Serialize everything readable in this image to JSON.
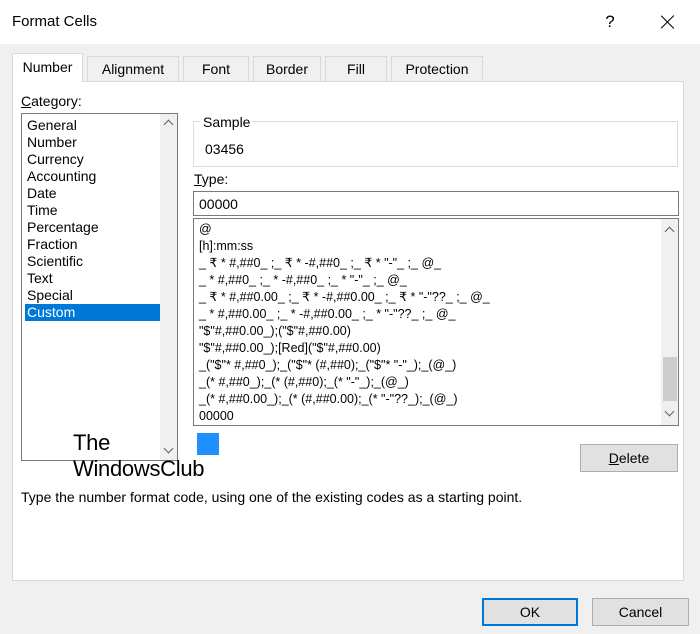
{
  "window": {
    "title": "Format Cells",
    "help": "?",
    "close_icon": "close-icon"
  },
  "tabs": [
    {
      "label": "Number",
      "active": true
    },
    {
      "label": "Alignment"
    },
    {
      "label": "Font"
    },
    {
      "label": "Border"
    },
    {
      "label": "Fill"
    },
    {
      "label": "Protection"
    }
  ],
  "category": {
    "label_first": "C",
    "label_rest": "ategory:",
    "items": [
      "General",
      "Number",
      "Currency",
      "Accounting",
      "Date",
      "Time",
      "Percentage",
      "Fraction",
      "Scientific",
      "Text",
      "Special",
      "Custom"
    ],
    "selected": "Custom"
  },
  "sample": {
    "legend": "Sample",
    "value": "03456"
  },
  "type": {
    "label_first": "T",
    "label_rest": "ype:",
    "value": "00000",
    "formats": [
      "@",
      "[h]:mm:ss",
      "_ ₹ * #,##0_ ;_ ₹ * -#,##0_ ;_ ₹ * \"-\"_ ;_ @_",
      "_ * #,##0_ ;_ * -#,##0_ ;_ * \"-\"_ ;_ @_",
      "_ ₹ * #,##0.00_ ;_ ₹ * -#,##0.00_ ;_ ₹ * \"-\"??_ ;_ @_",
      "_ * #,##0.00_ ;_ * -#,##0.00_ ;_ * \"-\"??_ ;_ @_",
      "\"$\"#,##0.00_);(\"$\"#,##0.00)",
      "\"$\"#,##0.00_);[Red](\"$\"#,##0.00)",
      "_(\"$\"* #,##0_);_(\"$\"* (#,##0);_(\"$\"* \"-\"_);_(@_)",
      "_(* #,##0_);_(* (#,##0);_(* \"-\"_);_(@_)",
      "_(* #,##0.00_);_(* (#,##0.00);_(* \"-\"??_);_(@_)",
      "00000"
    ]
  },
  "watermark": {
    "line1": "The",
    "line2": "WindowsClub"
  },
  "buttons": {
    "delete_first": "D",
    "delete_rest": "elete",
    "ok": "OK",
    "cancel": "Cancel"
  },
  "hint": "Type the number format code, using one of the existing codes as a starting point."
}
